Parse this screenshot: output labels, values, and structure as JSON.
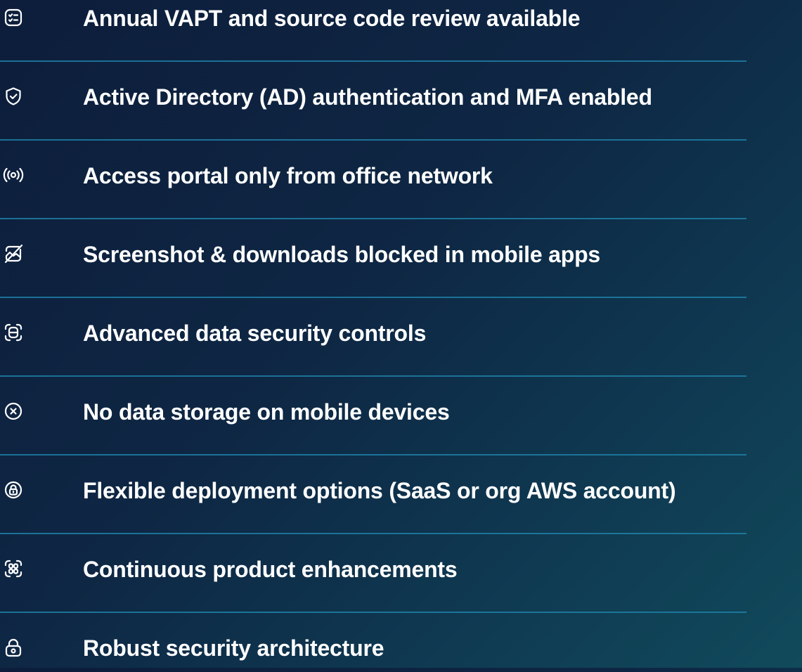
{
  "colors": {
    "text": "#ffffff",
    "divider": "#1f7fa6",
    "background_start": "#0d1d3b",
    "background_end": "#114a5b"
  },
  "features": [
    {
      "icon": "checklist-icon",
      "label": "Annual VAPT and source code review available"
    },
    {
      "icon": "shield-check-icon",
      "label": "Active Directory (AD) authentication and MFA enabled"
    },
    {
      "icon": "broadcast-signal-icon",
      "label": "Access portal only from office network"
    },
    {
      "icon": "screenshot-blocked-icon",
      "label": "Screenshot & downloads blocked in mobile apps"
    },
    {
      "icon": "data-scan-icon",
      "label": "Advanced data security controls"
    },
    {
      "icon": "close-circle-icon",
      "label": "No data storage on mobile devices"
    },
    {
      "icon": "lock-circle-icon",
      "label": "Flexible deployment options (SaaS or org AWS account)"
    },
    {
      "icon": "grid-scan-icon",
      "label": "Continuous product enhancements"
    },
    {
      "icon": "lock-icon",
      "label": "Robust security architecture"
    }
  ]
}
